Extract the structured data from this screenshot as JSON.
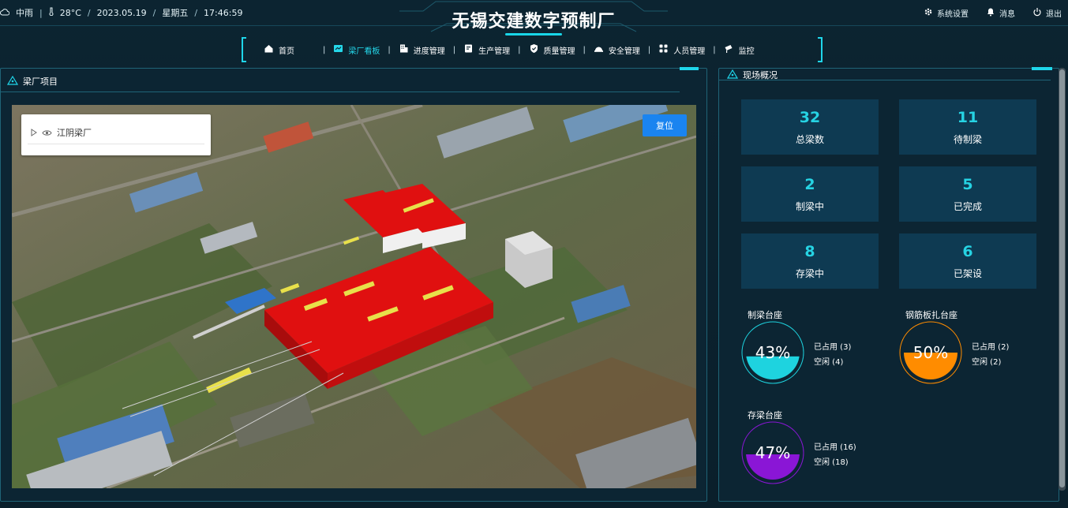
{
  "header": {
    "weather": "中雨",
    "temperature": "28°C",
    "date": "2023.05.19",
    "weekday": "星期五",
    "time": "17:46:59",
    "title": "无锡交建数字预制厂",
    "actions": [
      {
        "label": "系统设置",
        "icon": "gear-icon"
      },
      {
        "label": "消息",
        "icon": "bell-icon"
      },
      {
        "label": "退出",
        "icon": "power-icon"
      }
    ]
  },
  "nav": {
    "items": [
      {
        "label": "首页",
        "icon": "home-icon",
        "active": false
      },
      {
        "label": "梁厂看板",
        "icon": "chart-board-icon",
        "active": true
      },
      {
        "label": "进度管理",
        "icon": "building-icon",
        "active": false
      },
      {
        "label": "生产管理",
        "icon": "clipboard-icon",
        "active": false
      },
      {
        "label": "质量管理",
        "icon": "shield-check-icon",
        "active": false
      },
      {
        "label": "安全管理",
        "icon": "helmet-icon",
        "active": false
      },
      {
        "label": "人员管理",
        "icon": "grid-icon",
        "active": false
      },
      {
        "label": "监控",
        "icon": "camera-icon",
        "active": false
      }
    ]
  },
  "left_panel": {
    "title": "梁厂项目",
    "layer_name": "江阴梁厂",
    "reset_label": "复位"
  },
  "right_panel": {
    "title": "现场概况",
    "stats": [
      {
        "value": "32",
        "label": "总梁数"
      },
      {
        "value": "11",
        "label": "待制梁"
      },
      {
        "value": "2",
        "label": "制梁中"
      },
      {
        "value": "5",
        "label": "已完成"
      },
      {
        "value": "8",
        "label": "存梁中"
      },
      {
        "value": "6",
        "label": "已架设"
      }
    ],
    "gauges": [
      {
        "title": "制梁台座",
        "percent": "43%",
        "fill_fraction": 0.43,
        "occupied": "已占用 (3)",
        "idle": "空闲 (4)",
        "color": "#1ed3df"
      },
      {
        "title": "钢筋板扎台座",
        "percent": "50%",
        "fill_fraction": 0.5,
        "occupied": "已占用 (2)",
        "idle": "空闲 (2)",
        "color": "#ff8c00"
      },
      {
        "title": "存梁台座",
        "percent": "47%",
        "fill_fraction": 0.47,
        "occupied": "已占用 (16)",
        "idle": "空闲 (18)",
        "color": "#8a16d6"
      }
    ]
  },
  "colors": {
    "accent": "#1fd6ea",
    "card_bg": "#0e3a52",
    "stat_value": "#26d3e3",
    "reset_button": "#1a84f0",
    "building_red": "#e01010"
  }
}
